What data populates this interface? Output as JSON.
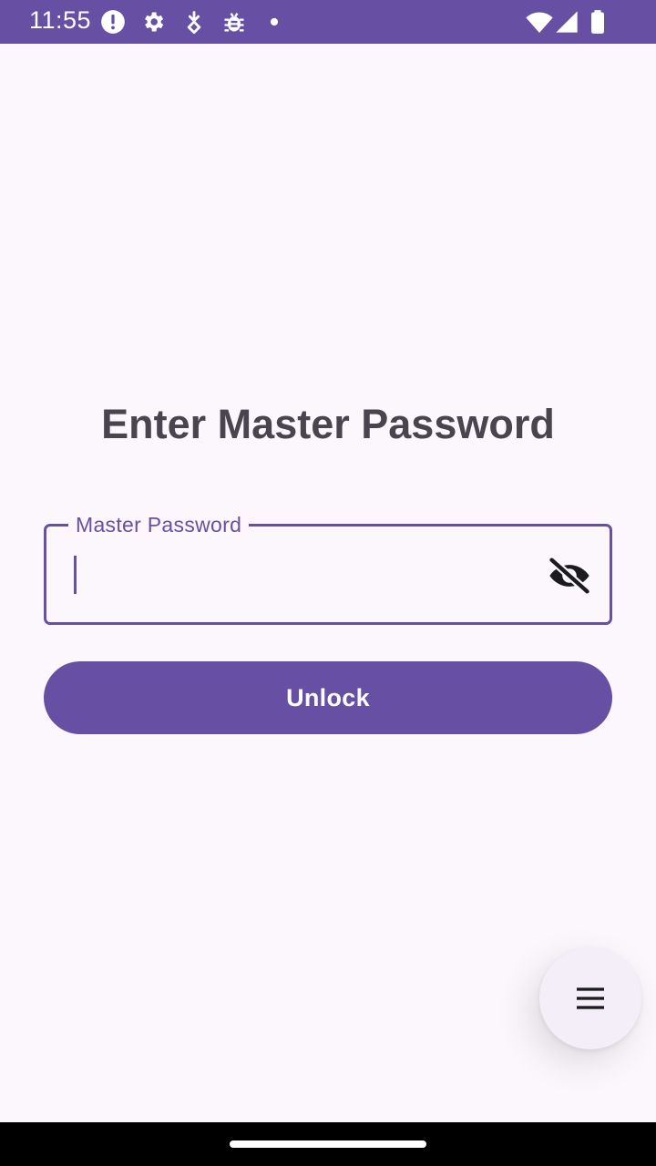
{
  "status_bar": {
    "time": "11:55",
    "left_icons": [
      "alert-icon",
      "settings-icon",
      "data-saver-icon",
      "bug-icon",
      "dot-icon"
    ],
    "right_icons": [
      "wifi-icon",
      "signal-icon",
      "battery-icon"
    ],
    "background": "#6750a4"
  },
  "screen": {
    "title": "Enter Master Password",
    "password_field": {
      "label": "Master Password",
      "value": "",
      "placeholder": "",
      "visibility_icon": "visibility-off-icon"
    },
    "unlock_button": "Unlock",
    "fab_icon": "menu-icon"
  },
  "colors": {
    "primary": "#6750a4",
    "background": "#fcf6fd",
    "title_text": "#49454f",
    "fab_background": "#f3eef8"
  }
}
